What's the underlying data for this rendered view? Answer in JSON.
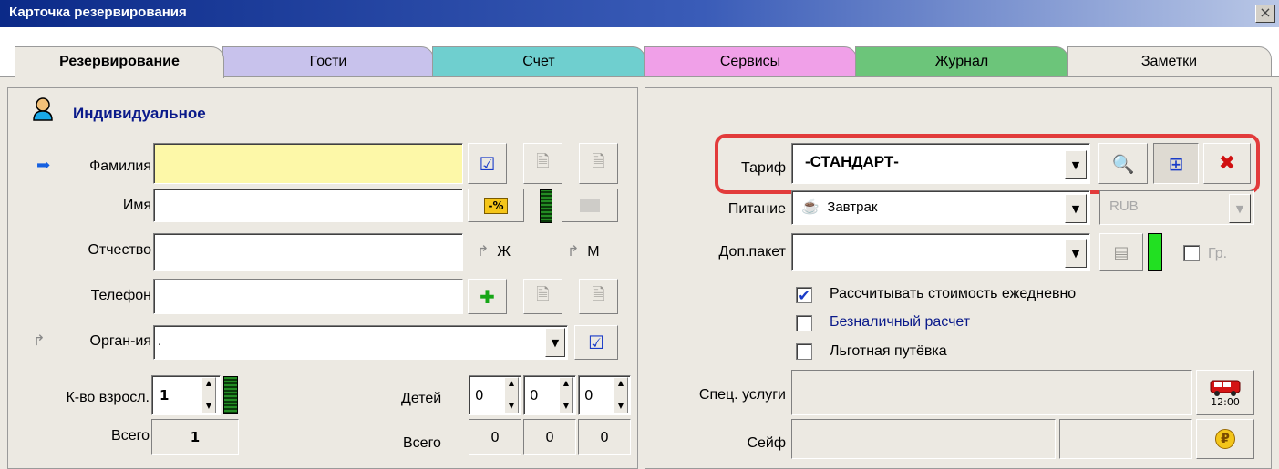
{
  "window": {
    "title": "Карточка резервирования",
    "close_symbol": "×"
  },
  "tabs": [
    {
      "label": "Резервирование",
      "color": "#ece9e2",
      "active": true
    },
    {
      "label": "Гости",
      "color": "#c8c2ec"
    },
    {
      "label": "Счет",
      "color": "#6fcfcf"
    },
    {
      "label": "Сервисы",
      "color": "#f0a0e8"
    },
    {
      "label": "Журнал",
      "color": "#6cc57a"
    },
    {
      "label": "Заметки",
      "color": "#ece9e2"
    }
  ],
  "left": {
    "heading": "Индивидуальное",
    "surname_label": "Фамилия",
    "name_label": "Имя",
    "patronymic_label": "Отчество",
    "phone_label": "Телефон",
    "org_label": "Орган-ия",
    "org_value": ".",
    "gender_f": "Ж",
    "gender_m": "М",
    "percent_label": "-%",
    "adults_label": "К-во взросл.",
    "adults_value": "1",
    "children_label": "Детей",
    "children_values": [
      "0",
      "0",
      "0"
    ],
    "total_label": "Всего",
    "total_value": "1",
    "children_total_label": "Всего",
    "children_totals": [
      "0",
      "0",
      "0"
    ]
  },
  "right": {
    "tariff_label": "Тариф",
    "tariff_value": "-СТАНДАРТ-",
    "meal_label": "Питание",
    "meal_value": "Завтрак",
    "currency_value": "RUB",
    "package_label": "Доп.пакет",
    "group_label": "Гр.",
    "check_daily": "Рассчитывать стоимость ежедневно",
    "check_daily_checked": true,
    "check_cashless": "Безналичный расчет",
    "check_discount": "Льготная путёвка",
    "special_label": "Спец. услуги",
    "transfer_time": "12:00",
    "safe_label": "Сейф"
  }
}
